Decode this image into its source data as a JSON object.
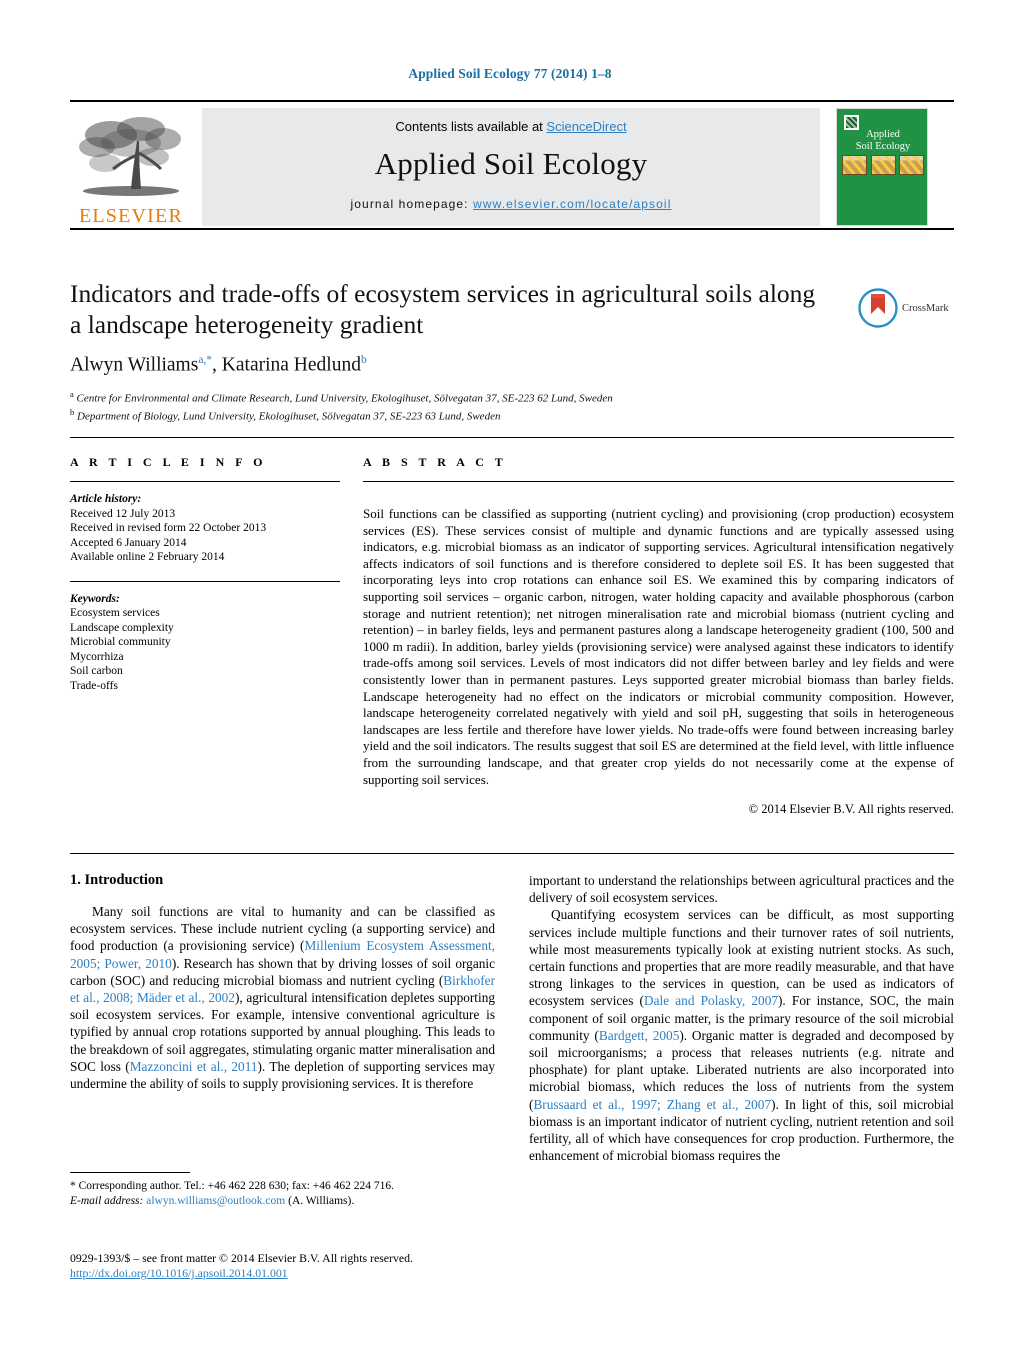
{
  "running_head": "Applied Soil Ecology 77 (2014) 1–8",
  "masthead": {
    "publisher_name": "ELSEVIER",
    "contents_prefix": "Contents lists available at ",
    "contents_link": "ScienceDirect",
    "journal_title": "Applied Soil Ecology",
    "homepage_prefix": "journal homepage: ",
    "homepage_url": "www.elsevier.com/locate/apsoil",
    "cover_title_line1": "Applied",
    "cover_title_line2": "Soil Ecology",
    "cover_color": "#1f9244",
    "link_color": "#2e7fc1",
    "elsevier_orange": "#e8790b"
  },
  "article": {
    "title": "Indicators and trade-offs of ecosystem services in agricultural soils along a landscape heterogeneity gradient",
    "authors_html": "Alwyn Williams<sup>a,*</sup>, Katarina Hedlund<sup>b</sup>",
    "affiliation_a": "Centre for Environmental and Climate Research, Lund University, Ekologihuset, Sölvegatan 37, SE-223 62 Lund, Sweden",
    "affiliation_b": "Department of Biology, Lund University, Ekologihuset, Sölvegatan 37, SE-223 63 Lund, Sweden",
    "crossmark_label": "CrossMark"
  },
  "article_info": {
    "heading": "A R T I C L E   I N F O",
    "history_label": "Article history:",
    "history": [
      "Received 12 July 2013",
      "Received in revised form 22 October 2013",
      "Accepted 6 January 2014",
      "Available online 2 February 2014"
    ],
    "keywords_label": "Keywords:",
    "keywords": [
      "Ecosystem services",
      "Landscape complexity",
      "Microbial community",
      "Mycorrhiza",
      "Soil carbon",
      "Trade-offs"
    ]
  },
  "abstract": {
    "heading": "A B S T R A C T",
    "text": "Soil functions can be classified as supporting (nutrient cycling) and provisioning (crop production) ecosystem services (ES). These services consist of multiple and dynamic functions and are typically assessed using indicators, e.g. microbial biomass as an indicator of supporting services. Agricultural intensification negatively affects indicators of soil functions and is therefore considered to deplete soil ES. It has been suggested that incorporating leys into crop rotations can enhance soil ES. We examined this by comparing indicators of supporting soil services – organic carbon, nitrogen, water holding capacity and available phosphorous (carbon storage and nutrient retention); net nitrogen mineralisation rate and microbial biomass (nutrient cycling and retention) – in barley fields, leys and permanent pastures along a landscape heterogeneity gradient (100, 500 and 1000 m radii). In addition, barley yields (provisioning service) were analysed against these indicators to identify trade-offs among soil services. Levels of most indicators did not differ between barley and ley fields and were consistently lower than in permanent pastures. Leys supported greater microbial biomass than barley fields. Landscape heterogeneity had no effect on the indicators or microbial community composition. However, landscape heterogeneity correlated negatively with yield and soil pH, suggesting that soils in heterogeneous landscapes are less fertile and therefore have lower yields. No trade-offs were found between increasing barley yield and the soil indicators. The results suggest that soil ES are determined at the field level, with little influence from the surrounding landscape, and that greater crop yields do not necessarily come at the expense of supporting soil services.",
    "copyright": "© 2014 Elsevier B.V. All rights reserved."
  },
  "body": {
    "section_heading": "1. Introduction",
    "left_para_1_html": "Many soil functions are vital to humanity and can be classified as ecosystem services. These include nutrient cycling (a supporting service) and food production (a provisioning service) (<span class=\"cite\">Millenium Ecosystem Assessment, 2005; Power, 2010</span>). Research has shown that by driving losses of soil organic carbon (SOC) and reducing microbial biomass and nutrient cycling (<span class=\"cite\">Birkhofer et al., 2008; Mäder et al., 2002</span>), agricultural intensification depletes supporting soil ecosystem services. For example, intensive conventional agriculture is typified by annual crop rotations supported by annual ploughing. This leads to the breakdown of soil aggregates, stimulating organic matter mineralisation and SOC loss (<span class=\"cite\">Mazzoncini et al., 2011</span>). The depletion of supporting services may undermine the ability of soils to supply provisioning services. It is therefore",
    "right_para_1_html": "important to understand the relationships between agricultural practices and the delivery of soil ecosystem services.",
    "right_para_2_html": "Quantifying ecosystem services can be difficult, as most supporting services include multiple functions and their turnover rates of soil nutrients, while most measurements typically look at existing nutrient stocks. As such, certain functions and properties that are more readily measurable, and that have strong linkages to the services in question, can be used as indicators of ecosystem services (<span class=\"cite\">Dale and Polasky, 2007</span>). For instance, SOC, the main component of soil organic matter, is the primary resource of the soil microbial community (<span class=\"cite\">Bardgett, 2005</span>). Organic matter is degraded and decomposed by soil microorganisms; a process that releases nutrients (e.g. nitrate and phosphate) for plant uptake. Liberated nutrients are also incorporated into microbial biomass, which reduces the loss of nutrients from the system (<span class=\"cite\">Brussaard et al., 1997; Zhang et al., 2007</span>). In light of this, soil microbial biomass is an important indicator of nutrient cycling, nutrient retention and soil fertility, all of which have consequences for crop production. Furthermore, the enhancement of microbial biomass requires the"
  },
  "footnote": {
    "corresponding_html": "* Corresponding author. Tel.: +46 462 228 630; fax: +46 462 224 716.",
    "email_html": "<span class=\"ital\">E-mail address:</span> <span class=\"cite\">alwyn.williams@outlook.com</span> (A. Williams)."
  },
  "footer": {
    "issn_line": "0929-1393/$ – see front matter © 2014 Elsevier B.V. All rights reserved.",
    "doi": "http://dx.doi.org/10.1016/j.apsoil.2014.01.001"
  }
}
